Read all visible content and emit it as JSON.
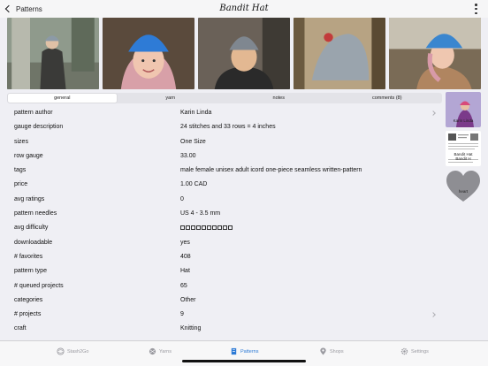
{
  "nav": {
    "back_label": "Patterns",
    "title": "Bandit Hat"
  },
  "photos": [
    {
      "name": "photo-woman-walking-outdoors",
      "hat": "#8c9aa6"
    },
    {
      "name": "photo-woman-blue-hat-portrait",
      "hat": "#2e7bd6"
    },
    {
      "name": "photo-man-grey-hat",
      "hat": "#7f8790"
    },
    {
      "name": "photo-grey-hat-pompom",
      "hat": "#9aa4ad"
    },
    {
      "name": "photo-woman-blue-hat-profile",
      "hat": "#3a86cf"
    }
  ],
  "segments": [
    {
      "label": "general",
      "active": true
    },
    {
      "label": "yarn",
      "active": false
    },
    {
      "label": "notes",
      "active": false
    },
    {
      "label": "comments (8)",
      "active": false
    }
  ],
  "details": [
    {
      "label": "pattern author",
      "value": "Karin Linda",
      "chevron": true
    },
    {
      "label": "gauge description",
      "value": "24 stitches and 33 rows = 4 inches"
    },
    {
      "label": "sizes",
      "value": "One Size"
    },
    {
      "label": "row gauge",
      "value": "33.00"
    },
    {
      "label": "tags",
      "value": "male female unisex adult icord one-piece seamless written-pattern"
    },
    {
      "label": "price",
      "value": "1.00 CAD"
    },
    {
      "label": "avg ratings",
      "value": "0"
    },
    {
      "label": "pattern needles",
      "value": "US 4  - 3.5 mm"
    },
    {
      "label": "avg difficulty",
      "value": "",
      "difficulty_boxes": 10
    },
    {
      "label": "downloadable",
      "value": "yes"
    },
    {
      "label": "# favorites",
      "value": "408"
    },
    {
      "label": "pattern type",
      "value": "Hat"
    },
    {
      "label": "# queued projects",
      "value": "65"
    },
    {
      "label": "categories",
      "value": "Other"
    },
    {
      "label": "# projects",
      "value": "9",
      "chevron": true
    },
    {
      "label": "craft",
      "value": "Knitting"
    }
  ],
  "side": {
    "author_thumb_caption": "Karin Linda",
    "pdf_thumb_caption": "Bandit Hat\nBandit H",
    "favorite_caption": "heart"
  },
  "tabbar": [
    {
      "label": "Stash2Go",
      "icon": "yarn-ball-icon",
      "active": false
    },
    {
      "label": "Yarns",
      "icon": "yarn-icon",
      "active": false
    },
    {
      "label": "Patterns",
      "icon": "pattern-icon",
      "active": true
    },
    {
      "label": "Shops",
      "icon": "map-pin-icon",
      "active": false
    },
    {
      "label": "Settings",
      "icon": "gear-icon",
      "active": false
    }
  ],
  "colors": {
    "accent": "#2e7bd6",
    "background": "#efeff4",
    "heart": "#8e8e93"
  }
}
